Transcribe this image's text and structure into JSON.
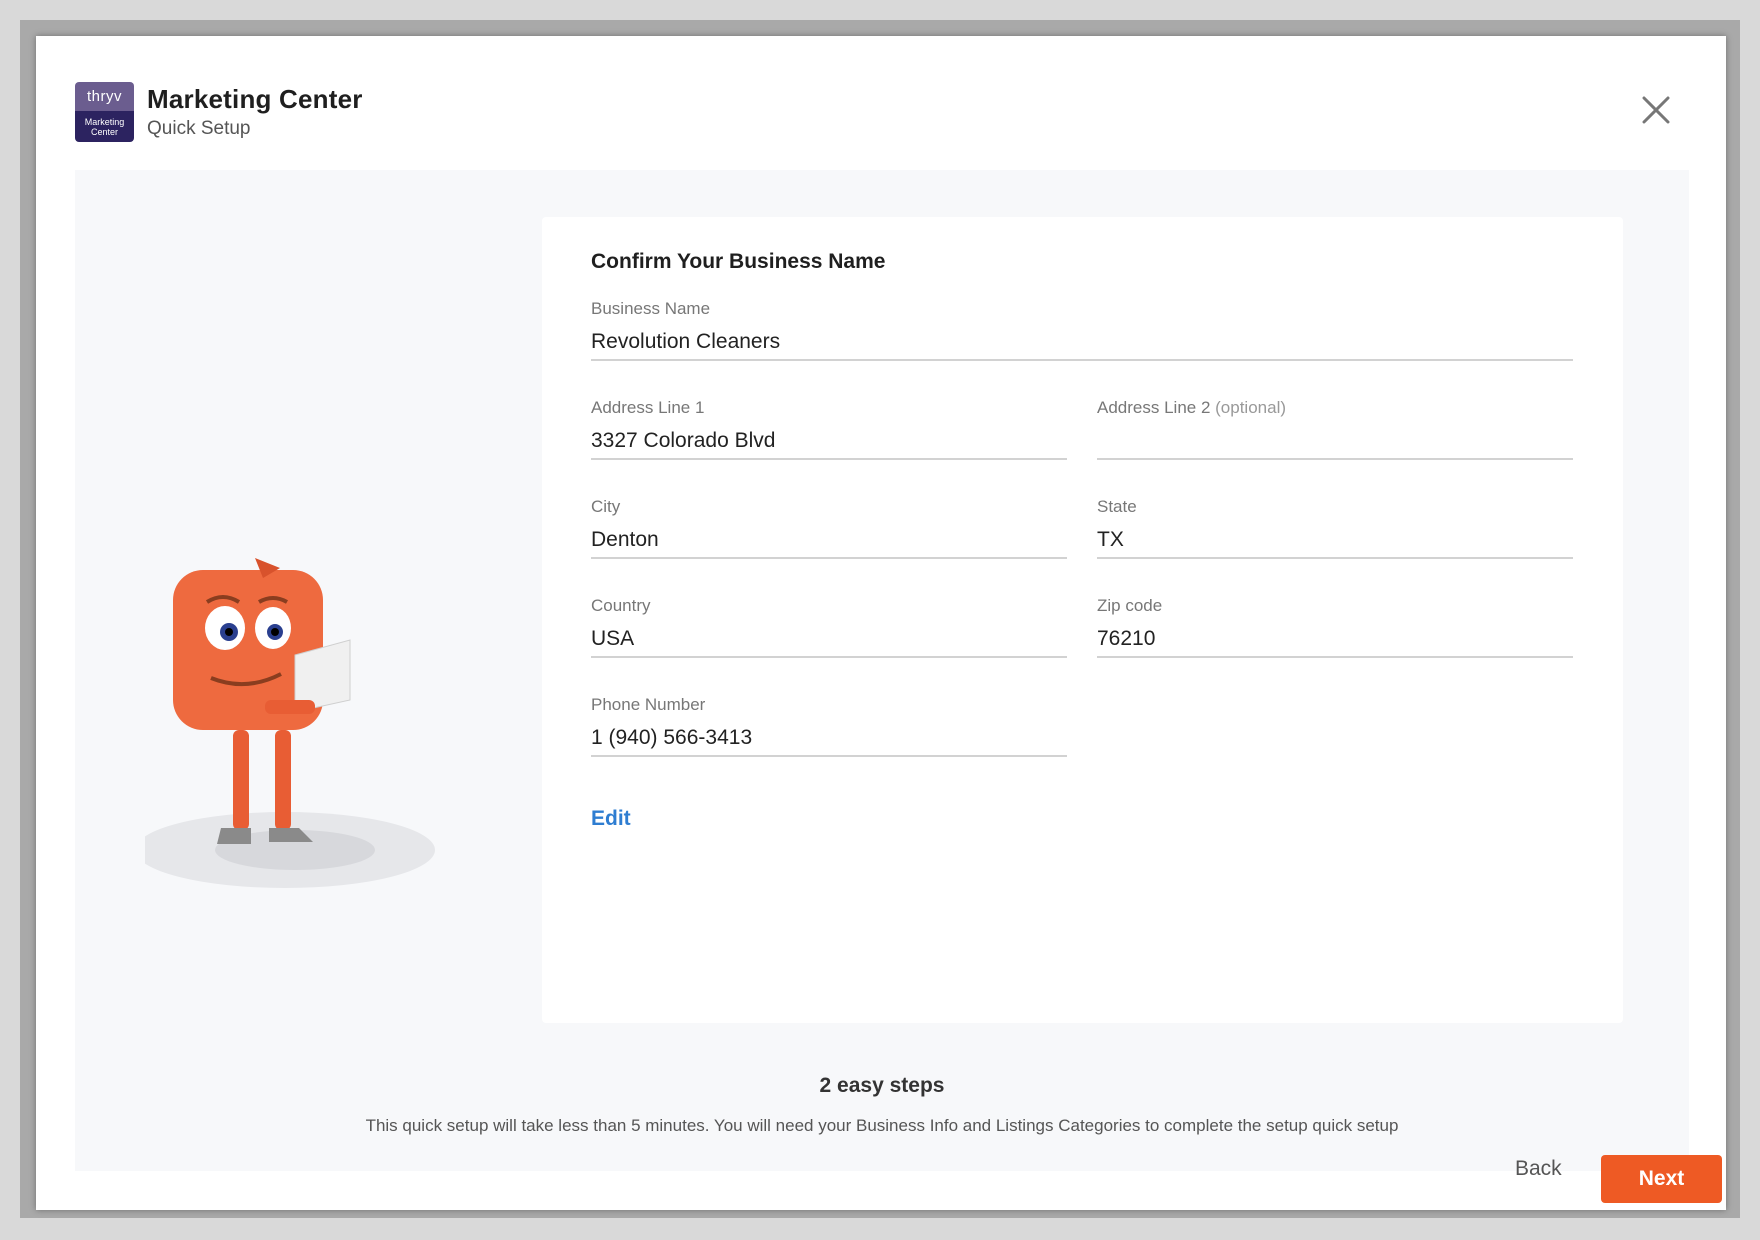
{
  "header": {
    "logo_top": "thryv",
    "logo_bottom_line1": "Marketing",
    "logo_bottom_line2": "Center",
    "title": "Marketing Center",
    "subtitle": "Quick Setup"
  },
  "form": {
    "title": "Confirm Your Business Name",
    "business_name": {
      "label": "Business Name",
      "value": "Revolution Cleaners"
    },
    "address1": {
      "label": "Address Line 1",
      "value": "3327 Colorado Blvd"
    },
    "address2": {
      "label": "Address Line 2",
      "optional": "(optional)",
      "value": ""
    },
    "city": {
      "label": "City",
      "value": "Denton"
    },
    "state": {
      "label": "State",
      "value": "TX"
    },
    "country": {
      "label": "Country",
      "value": "USA"
    },
    "zip": {
      "label": "Zip code",
      "value": "76210"
    },
    "phone": {
      "label": "Phone Number",
      "value": "1 (940) 566-3413"
    },
    "edit_label": "Edit"
  },
  "footer": {
    "steps_title": "2 easy steps",
    "steps_desc": "This quick setup will take less than 5 minutes. You will need your Business Info and Listings Categories to complete the setup quick setup",
    "back_label": "Back",
    "next_label": "Next"
  },
  "colors": {
    "accent": "#ee5a24",
    "link": "#2e7dd1",
    "logo_dark": "#2c2360"
  }
}
